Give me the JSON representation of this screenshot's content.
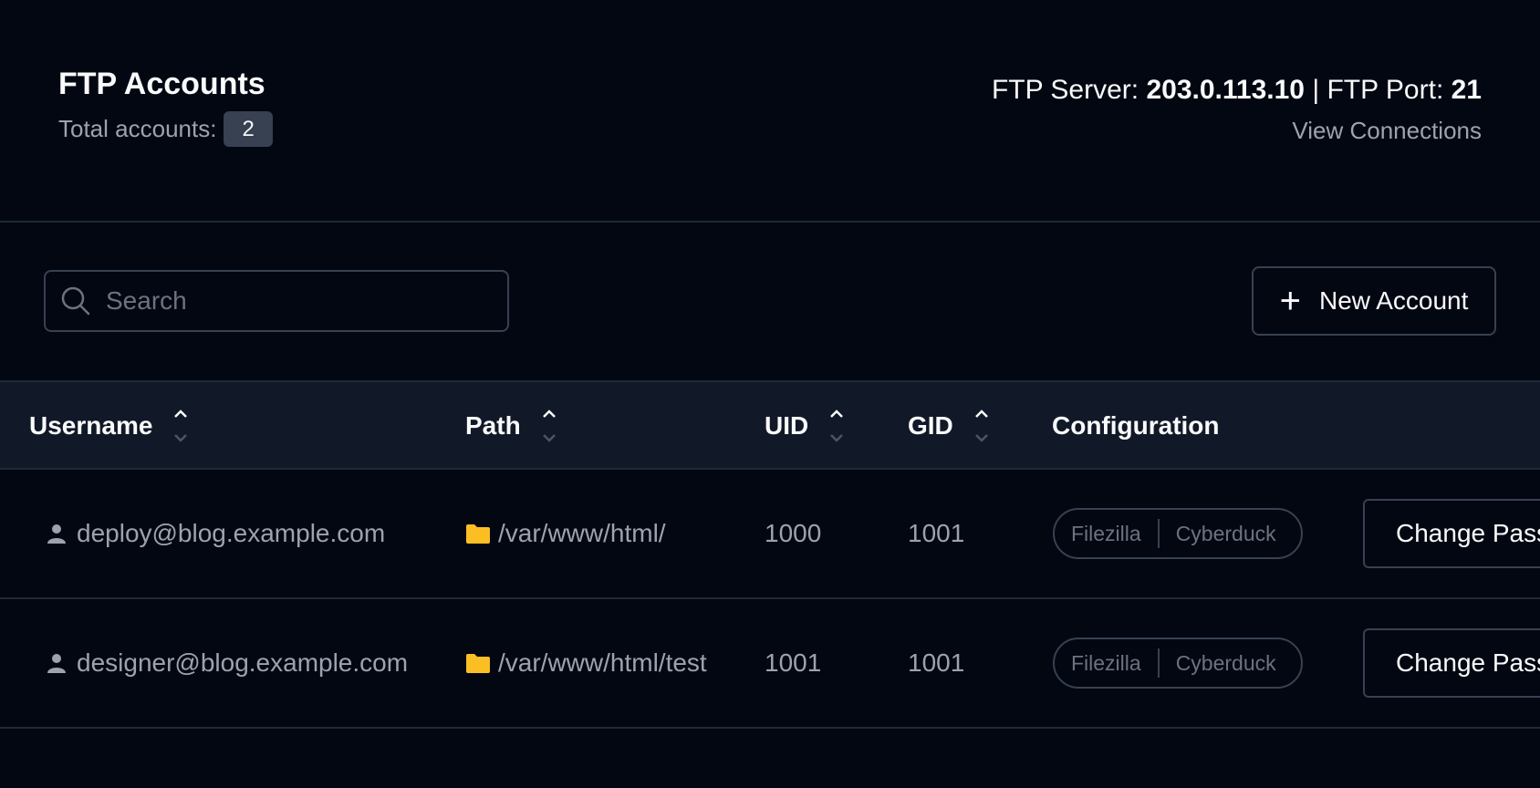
{
  "header": {
    "title": "FTP Accounts",
    "total_label": "Total accounts:",
    "total_count": "2",
    "server_label": "FTP Server:",
    "server_value": "203.0.113.10",
    "separator": "|",
    "port_label": "FTP Port:",
    "port_value": "21",
    "view_connections": "View Connections"
  },
  "toolbar": {
    "search_placeholder": "Search",
    "search_value": "",
    "new_account_label": "New Account"
  },
  "table": {
    "columns": [
      "Username",
      "Path",
      "UID",
      "GID",
      "Configuration"
    ],
    "rows": [
      {
        "username": "deploy@blog.example.com",
        "path": "/var/www/html/",
        "uid": "1000",
        "gid": "1001",
        "config": [
          "Filezilla",
          "Cyberduck"
        ],
        "action": "Change Password"
      },
      {
        "username": "designer@blog.example.com",
        "path": "/var/www/html/test",
        "uid": "1001",
        "gid": "1001",
        "config": [
          "Filezilla",
          "Cyberduck"
        ],
        "action": "Change Password"
      }
    ]
  },
  "colors": {
    "background": "#030712",
    "header_row": "#111827",
    "border": "#374151",
    "muted_text": "#9ca3af",
    "folder": "#fbbf24"
  }
}
